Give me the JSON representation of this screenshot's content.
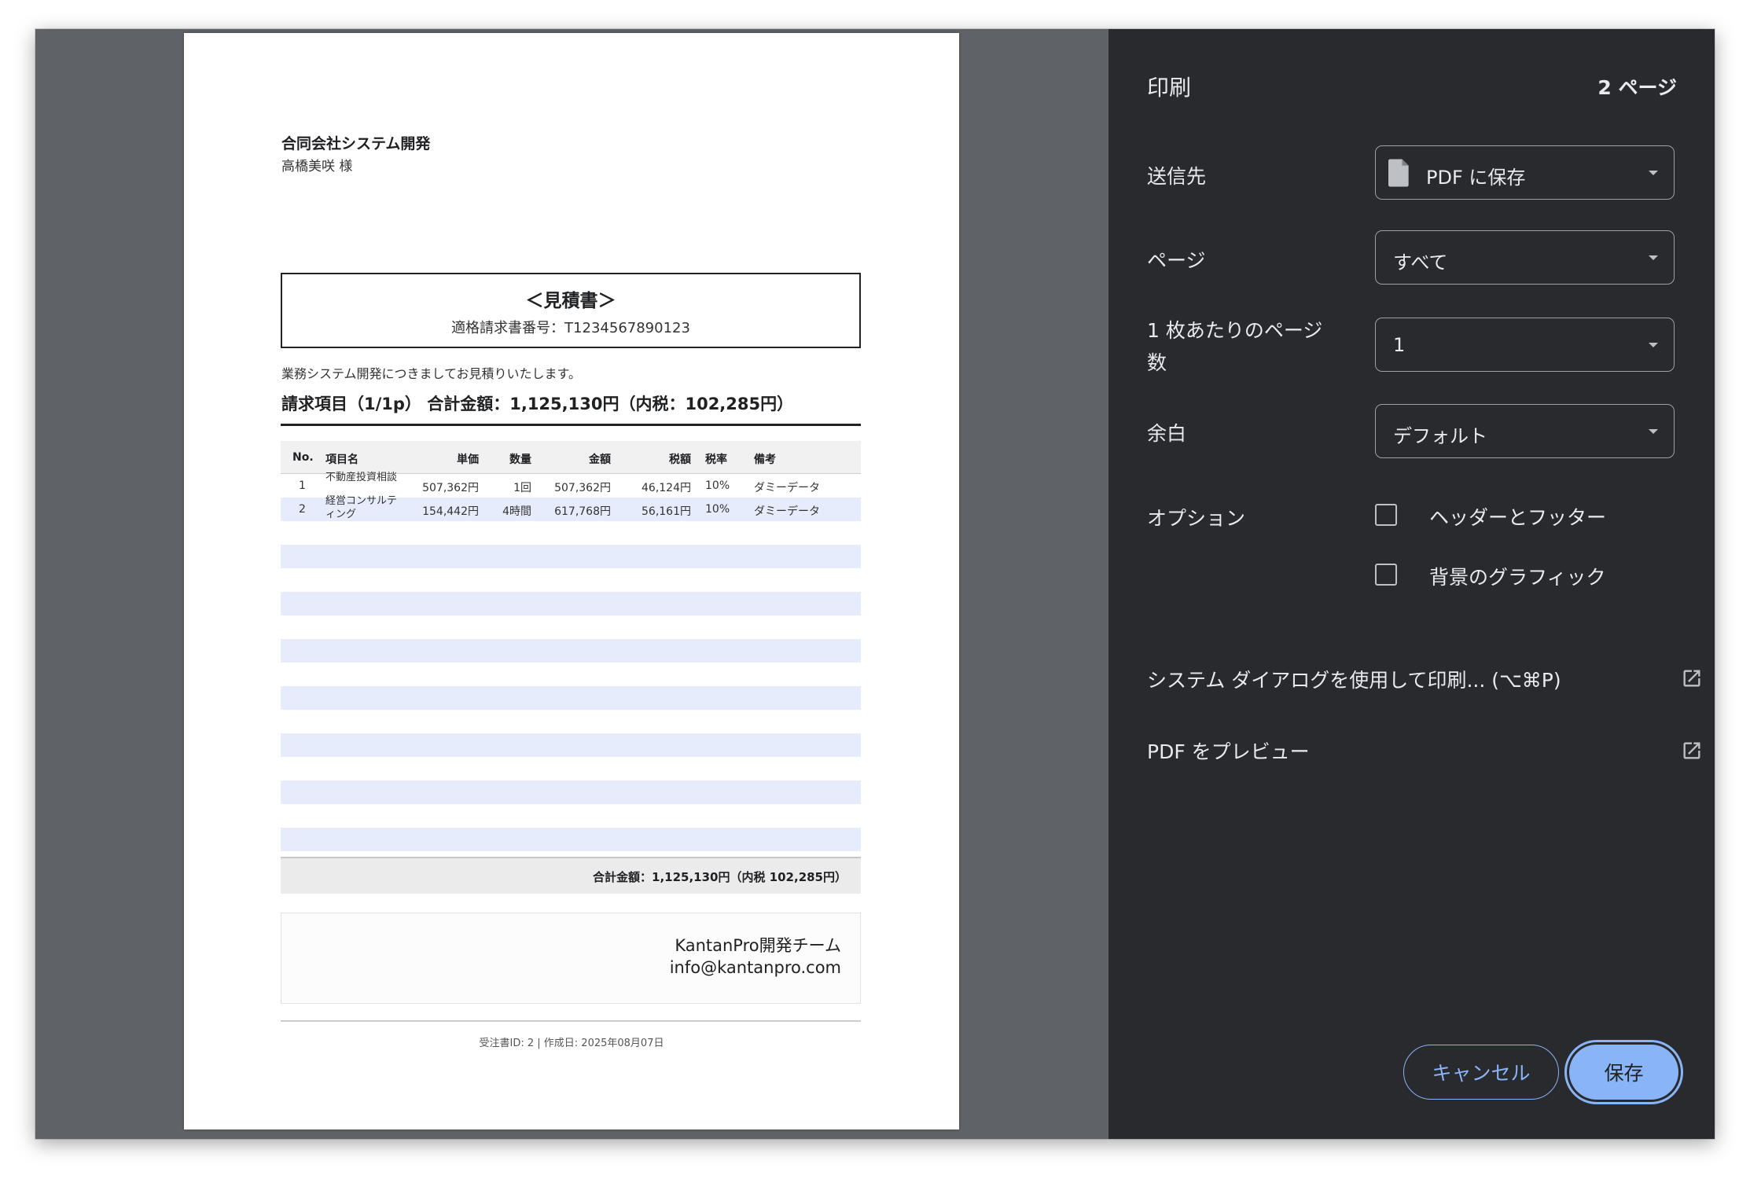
{
  "document": {
    "company": "合同会社システム開発",
    "contact": "高橋美咲 様",
    "title": "＜見積書＞",
    "registration": "適格請求書番号：T1234567890123",
    "intro": "業務システム開発につきましてお見積りいたします。",
    "summary": "請求項目（1/1p）  合計金額：1,125,130円（内税：102,285円）",
    "table": {
      "headers": [
        "No.",
        "項目名",
        "単価",
        "数量",
        "金額",
        "税額",
        "税率",
        "備考"
      ],
      "rows": [
        [
          "1",
          "不動産投資相談",
          "507,362円",
          "1回",
          "507,362円",
          "46,124円",
          "10%",
          "ダミーデータ"
        ],
        [
          "2",
          "経営コンサルティング",
          "154,442円",
          "4時間",
          "617,768円",
          "56,161円",
          "10%",
          "ダミーデータ"
        ]
      ]
    },
    "total": "合計金額：1,125,130円（内税 102,285円）",
    "team": "KantanPro開発チーム",
    "email": "info@kantanpro.com",
    "meta": "受注書ID: 2 | 作成日: 2025年08月07日"
  },
  "panel": {
    "title": "印刷",
    "page_count": "2 ページ",
    "destination_label": "送信先",
    "destination_value": "PDF に保存",
    "pages_label": "ページ",
    "pages_value": "すべて",
    "per_sheet_label_1": "1 枚あたりのページ",
    "per_sheet_label_2": "数",
    "per_sheet_value": "1",
    "margins_label": "余白",
    "margins_value": "デフォルト",
    "options_label": "オプション",
    "option_headers": "ヘッダーとフッター",
    "option_background": "背景のグラフィック",
    "system_dialog": "システム ダイアログを使用して印刷... (⌥⌘P)",
    "pdf_preview": "PDF をプレビュー",
    "cancel": "キャンセル",
    "save": "保存"
  },
  "colors": {
    "panel_bg": "#292a2d",
    "preview_bg": "#5f6368",
    "accent": "#8ab4f8",
    "stripe": "#e6ecfb"
  }
}
